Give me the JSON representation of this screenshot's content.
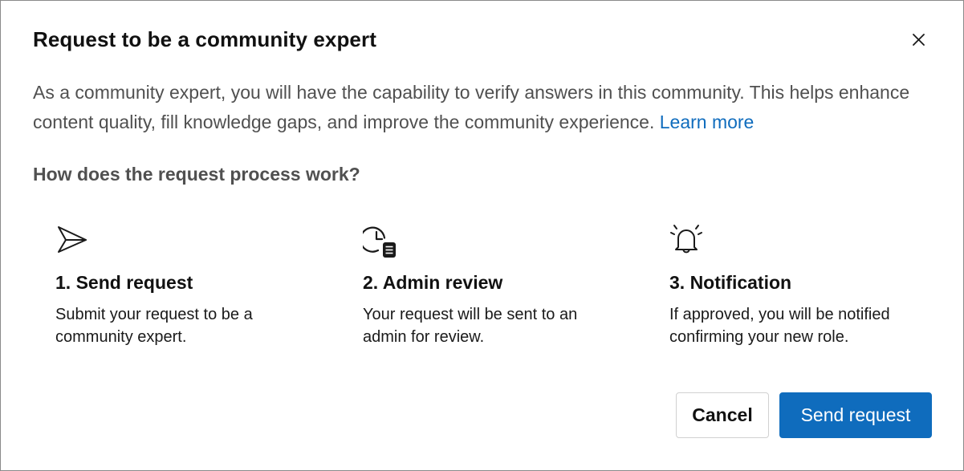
{
  "dialog": {
    "title": "Request to be a community expert",
    "close_icon": "close-icon",
    "description": "As a community expert, you will have the capability to verify answers in this community. This helps enhance content quality, fill knowledge gaps, and improve the community experience.",
    "learn_more": "Learn more",
    "process_heading": "How does the request process work?"
  },
  "steps": [
    {
      "icon": "send-icon",
      "title": "1. Send request",
      "description": "Submit your request to be a community expert."
    },
    {
      "icon": "clock-document-icon",
      "title": "2. Admin review",
      "description": "Your request will be sent to an admin for review."
    },
    {
      "icon": "bell-alert-icon",
      "title": "3. Notification",
      "description": "If approved, you will be notified confirming your new role."
    }
  ],
  "footer": {
    "cancel_label": "Cancel",
    "send_label": "Send request"
  },
  "colors": {
    "accent": "#0f6cbd",
    "text_primary": "#111111",
    "text_secondary": "#505050"
  }
}
